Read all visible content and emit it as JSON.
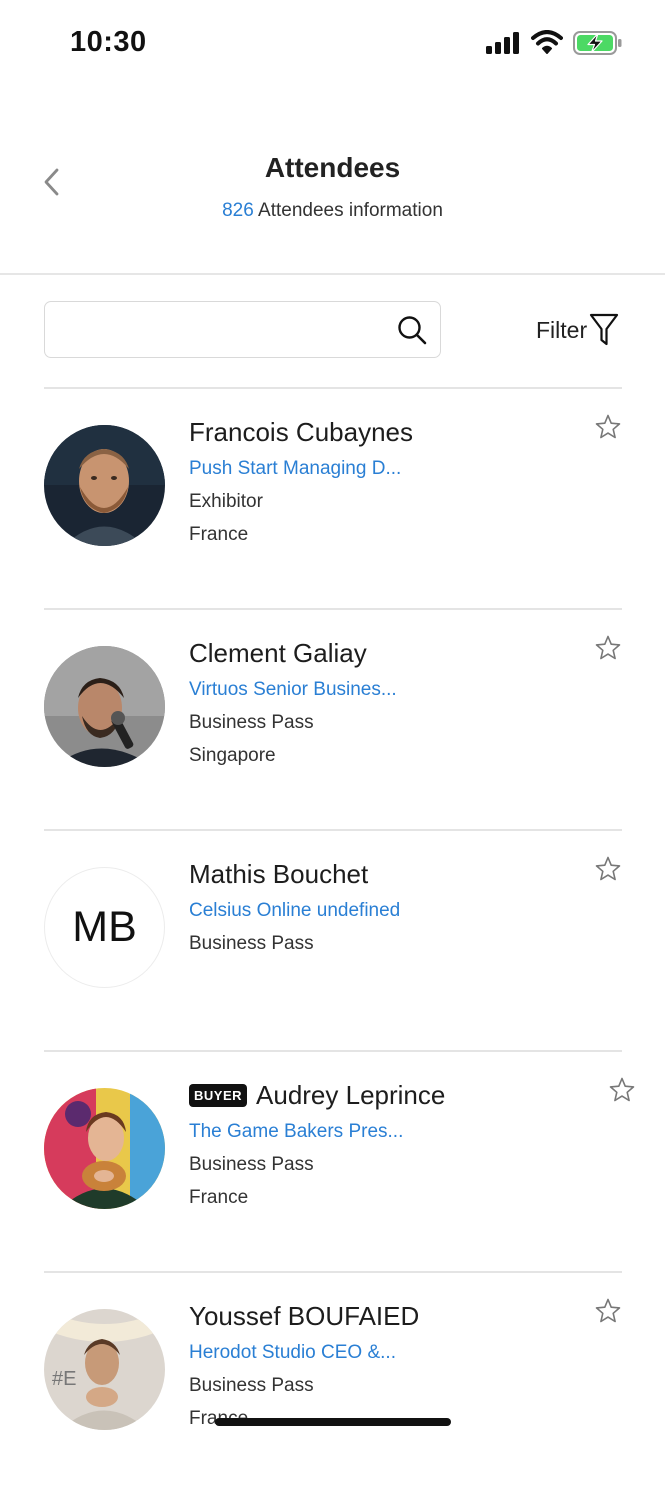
{
  "status_bar": {
    "time": "10:30"
  },
  "header": {
    "title": "Attendees",
    "attendee_count": "826",
    "subtitle_text": "Attendees information"
  },
  "search": {
    "value": "",
    "placeholder": ""
  },
  "filter": {
    "label": "Filter"
  },
  "colors": {
    "accent": "#2a7fd4",
    "divider": "#e4e4e4",
    "badge_bg": "#111111"
  },
  "attendees": [
    {
      "name": "Francois Cubaynes",
      "company": "Push Start Managing D...",
      "pass": "Exhibitor",
      "country": "France",
      "avatar": "photo",
      "badge": ""
    },
    {
      "name": "Clement Galiay",
      "company": "Virtuos Senior Busines...",
      "pass": "Business Pass",
      "country": "Singapore",
      "avatar": "photo",
      "badge": ""
    },
    {
      "name": "Mathis Bouchet",
      "company": "Celsius Online undefined",
      "pass": "Business Pass",
      "country": "",
      "avatar": "initials",
      "initials": "MB",
      "badge": ""
    },
    {
      "name": "Audrey Leprince",
      "company": "The Game Bakers Pres...",
      "pass": "Business Pass",
      "country": "France",
      "avatar": "photo",
      "badge": "BUYER"
    },
    {
      "name": "Youssef BOUFAIED",
      "company": "Herodot Studio CEO &...",
      "pass": "Business Pass",
      "country": "France",
      "avatar": "photo",
      "badge": ""
    }
  ]
}
